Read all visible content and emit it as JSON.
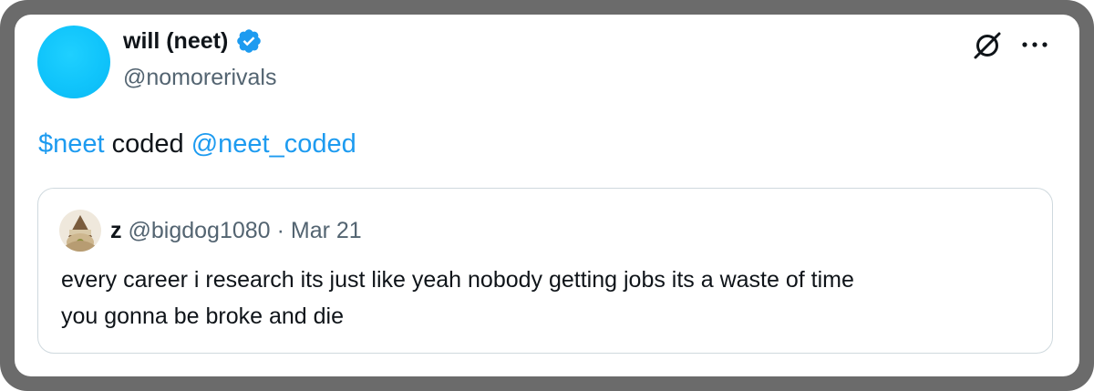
{
  "author": {
    "display_name": "will (neet)",
    "handle": "@nomorerivals",
    "verified": true,
    "avatar_color": "#10c4fb",
    "verified_icon": "verified-badge-icon"
  },
  "header_actions": {
    "grok_icon": "grok-icon",
    "more_icon": "more-options-icon"
  },
  "tweet": {
    "cashtag": "$neet",
    "text": " coded ",
    "mention": "@neet_coded",
    "link_color": "#1d9bf0"
  },
  "quoted_tweet": {
    "display_name": "z",
    "handle": "@bigdog1080",
    "separator": "·",
    "date": "Mar 21",
    "text_line1": "every career i research its just like yeah nobody getting jobs its a waste of time",
    "text_line2": "you gonna be broke and die"
  }
}
